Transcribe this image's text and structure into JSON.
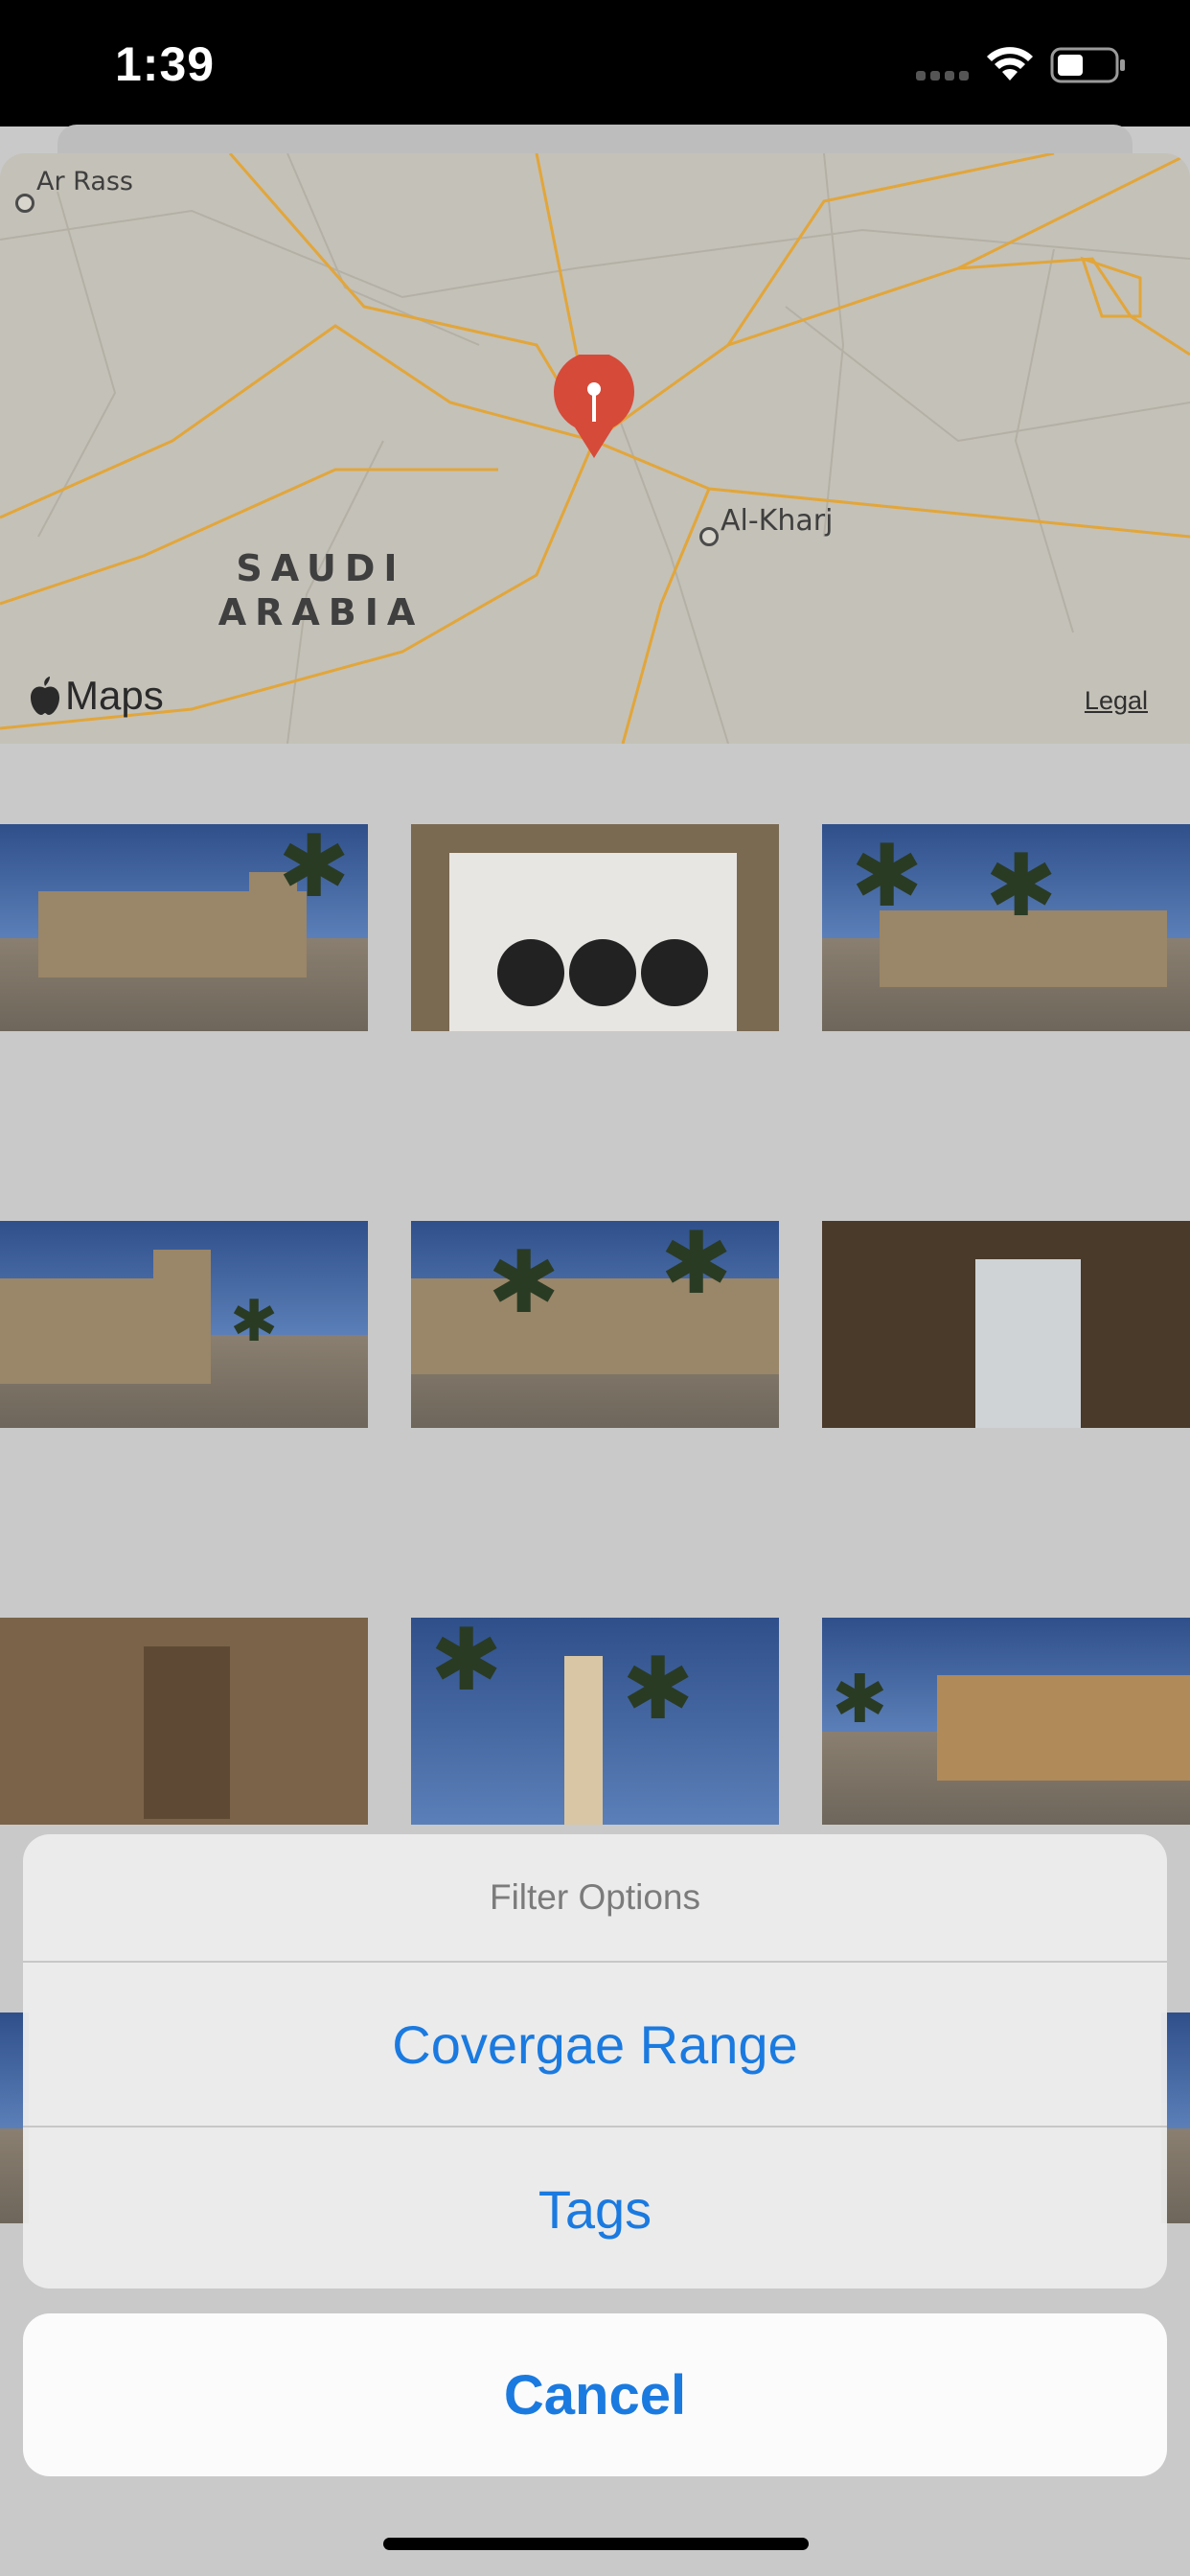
{
  "status_bar": {
    "time": "1:39"
  },
  "map": {
    "city_labels": {
      "ar_rass": "Ar Rass",
      "al_kharj": "Al-Kharj"
    },
    "country_label": "SAUDI ARABIA",
    "attribution": "Maps",
    "legal": "Legal",
    "road_color": "#e2a63a",
    "pin_color": "#d64a3a"
  },
  "action_sheet": {
    "title": "Filter Options",
    "options": [
      {
        "label": "Covergae Range"
      },
      {
        "label": "Tags"
      }
    ],
    "cancel_label": "Cancel",
    "accent_color": "#1a7ae0"
  }
}
